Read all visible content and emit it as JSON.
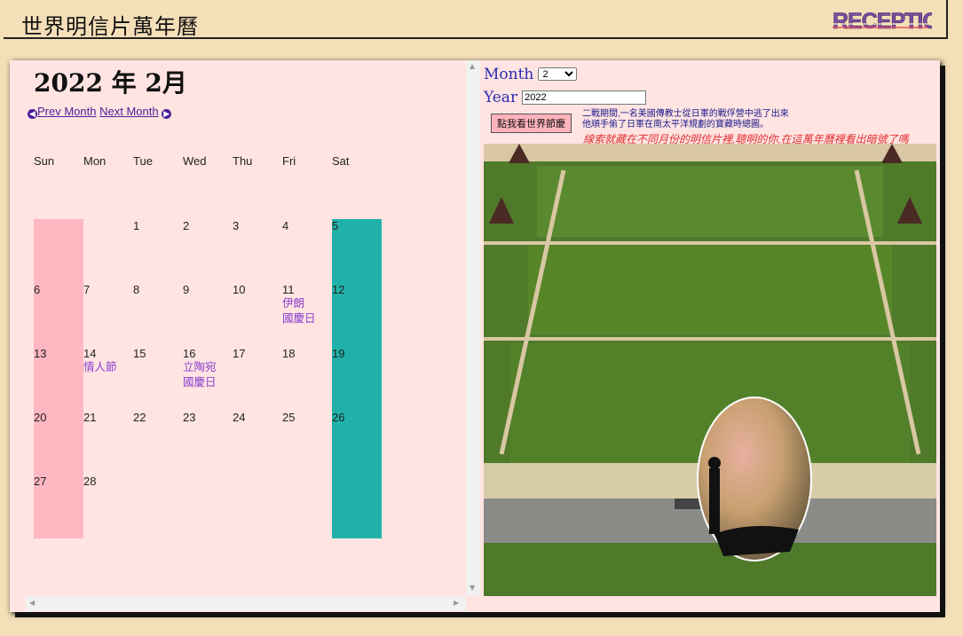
{
  "header": {
    "title": "世界明信片萬年曆",
    "logo_text": "RECEPTION"
  },
  "calendar": {
    "month_title": "2022 年 2月",
    "prev_label": "Prev Month",
    "next_label": "Next Month",
    "weekdays": [
      "Sun",
      "Mon",
      "Tue",
      "Wed",
      "Thu",
      "Fri",
      "Sat"
    ],
    "weeks": [
      [
        {
          "d": ""
        },
        {
          "d": ""
        },
        {
          "d": "1"
        },
        {
          "d": "2"
        },
        {
          "d": "3"
        },
        {
          "d": "4"
        },
        {
          "d": "5"
        }
      ],
      [
        {
          "d": "6"
        },
        {
          "d": "7"
        },
        {
          "d": "8"
        },
        {
          "d": "9"
        },
        {
          "d": "10"
        },
        {
          "d": "11",
          "h1": "伊朗",
          "h2": "國慶日"
        },
        {
          "d": "12"
        }
      ],
      [
        {
          "d": "13"
        },
        {
          "d": "14",
          "h1": "情人節"
        },
        {
          "d": "15"
        },
        {
          "d": "16",
          "h1": "立陶宛",
          "h2": "國慶日"
        },
        {
          "d": "17"
        },
        {
          "d": "18"
        },
        {
          "d": "19"
        }
      ],
      [
        {
          "d": "20"
        },
        {
          "d": "21"
        },
        {
          "d": "22"
        },
        {
          "d": "23"
        },
        {
          "d": "24"
        },
        {
          "d": "25"
        },
        {
          "d": "26"
        }
      ],
      [
        {
          "d": "27"
        },
        {
          "d": "28"
        },
        {
          "d": ""
        },
        {
          "d": ""
        },
        {
          "d": ""
        },
        {
          "d": ""
        },
        {
          "d": ""
        }
      ]
    ]
  },
  "form": {
    "month_label": "Month",
    "month_value": "2",
    "year_label": "Year",
    "year_value": "2022",
    "button_label": "點我看世界節慶",
    "story_line1": "二戰期間,一名美國傳教士從日軍的戰俘營中逃了出來",
    "story_line2": "他順手偷了日軍在南太平洋規劃的寶藏時總圖。",
    "hint": "線索就藏在不同月份的明信片裡,聰明的你,在這萬年曆裡看出暗號了嗎"
  },
  "colors": {
    "sunday": "#ffb7c1",
    "saturday": "#20b2aa",
    "panel": "#ffe4e2",
    "page": "#f5dfb8"
  }
}
